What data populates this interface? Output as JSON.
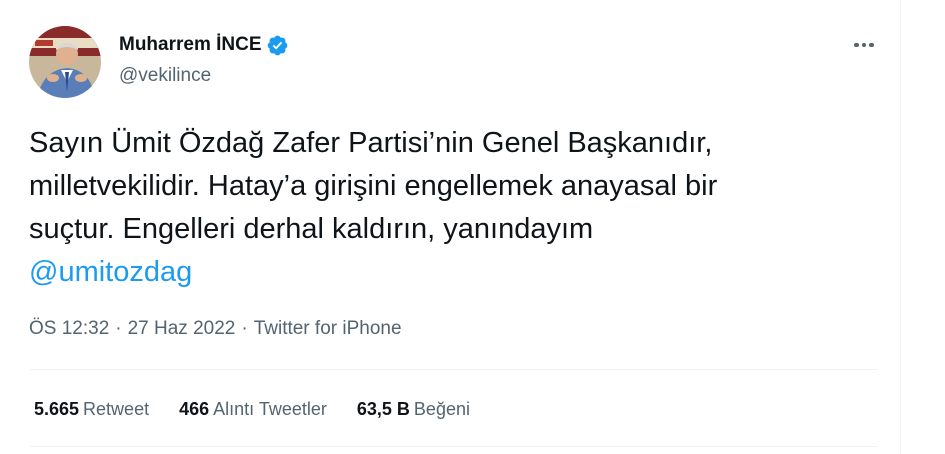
{
  "author": {
    "display_name": "Muharrem İNCE",
    "handle": "@vekilince",
    "avatar_icon": "profile-photo",
    "verified_icon": "verified-badge-icon",
    "verified_color": "#1d9bf0"
  },
  "tweet": {
    "text_lines": [
      "Sayın Ümit Özdağ Zafer Partisi’nin Genel Başkanıdır,",
      "milletvekilidir. Hatay’a girişini engellemek anayasal bir",
      "suçtur. Engelleri derhal kaldırın, yanındayım"
    ],
    "mention": "@umitozdag",
    "time": "ÖS 12:32",
    "date": "27 Haz 2022",
    "source": "Twitter for iPhone",
    "separator": "·"
  },
  "stats": [
    {
      "value": "5.665",
      "label": "Retweet"
    },
    {
      "value": "466",
      "label": "Alıntı Tweetler"
    },
    {
      "value": "63,5 B",
      "label": "Beğeni"
    }
  ],
  "colors": {
    "accent": "#1d9bf0",
    "text_primary": "#0f1419",
    "text_secondary": "#536471",
    "divider": "#eff3f4"
  },
  "icons": {
    "more": "more-horizontal-icon"
  }
}
